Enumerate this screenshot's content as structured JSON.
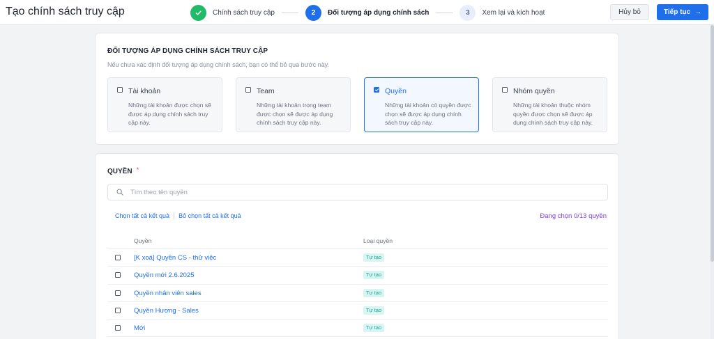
{
  "header": {
    "title": "Tạo chính sách truy cập",
    "steps": [
      {
        "number": "✓",
        "label": "Chính sách truy cập",
        "status": "done"
      },
      {
        "number": "2",
        "label": "Đối tượng áp dụng chính sách",
        "status": "active"
      },
      {
        "number": "3",
        "label": "Xem lại và kích hoạt",
        "status": "todo"
      }
    ],
    "cancel_label": "Hủy bỏ",
    "next_label": "Tiếp tục",
    "next_arrow": "→"
  },
  "target_section": {
    "title": "ĐỐI TƯỢNG ÁP DỤNG CHÍNH SÁCH TRUY CẬP",
    "subtitle": "Nếu chưa xác định đối tượng áp dụng chính sách, bạn có thể bỏ qua bước này.",
    "options": [
      {
        "title": "Tài khoản",
        "desc": "Những tài khoản được chọn sẽ được áp dụng chính sách truy cập này.",
        "checked": false
      },
      {
        "title": "Team",
        "desc": "Những tài khoản trong team được chọn sẽ được áp dụng chính sách truy cập này.",
        "checked": false
      },
      {
        "title": "Quyền",
        "desc": "Những tài khoản có quyền được chọn sẽ được áp dụng chính sách truy cập này.",
        "checked": true
      },
      {
        "title": "Nhóm quyền",
        "desc": "Những tài khoản thuộc nhóm quyền được chọn sẽ được áp dụng chính sách truy cập này.",
        "checked": false
      }
    ]
  },
  "roles_section": {
    "title": "QUYỀN",
    "required_mark": "*",
    "search_placeholder": "Tìm theo tên quyền",
    "select_all_label": "Chọn tất cả kết quả",
    "deselect_all_label": "Bỏ chọn tất cả kết quả",
    "selected_count": "Đang chọn 0/13 quyền",
    "columns": [
      "Quyền",
      "Loại quyền"
    ],
    "rows": [
      {
        "name": "[K xoá] Quyền CS - thử việc",
        "type": "Tự tạo"
      },
      {
        "name": "Quyền mới 2.6.2025",
        "type": "Tự tạo"
      },
      {
        "name": "Quyền nhân viên sales",
        "type": "Tự tạo"
      },
      {
        "name": "Quyền Hương - Sales",
        "type": "Tự tạo"
      },
      {
        "name": "Mới",
        "type": "Tự tạo"
      }
    ]
  },
  "colors": {
    "accent": "#1f6feb",
    "success": "#22b968",
    "badge_bg": "#d9f5f2",
    "badge_text": "#17a596",
    "count_text": "#7a3fe0"
  }
}
